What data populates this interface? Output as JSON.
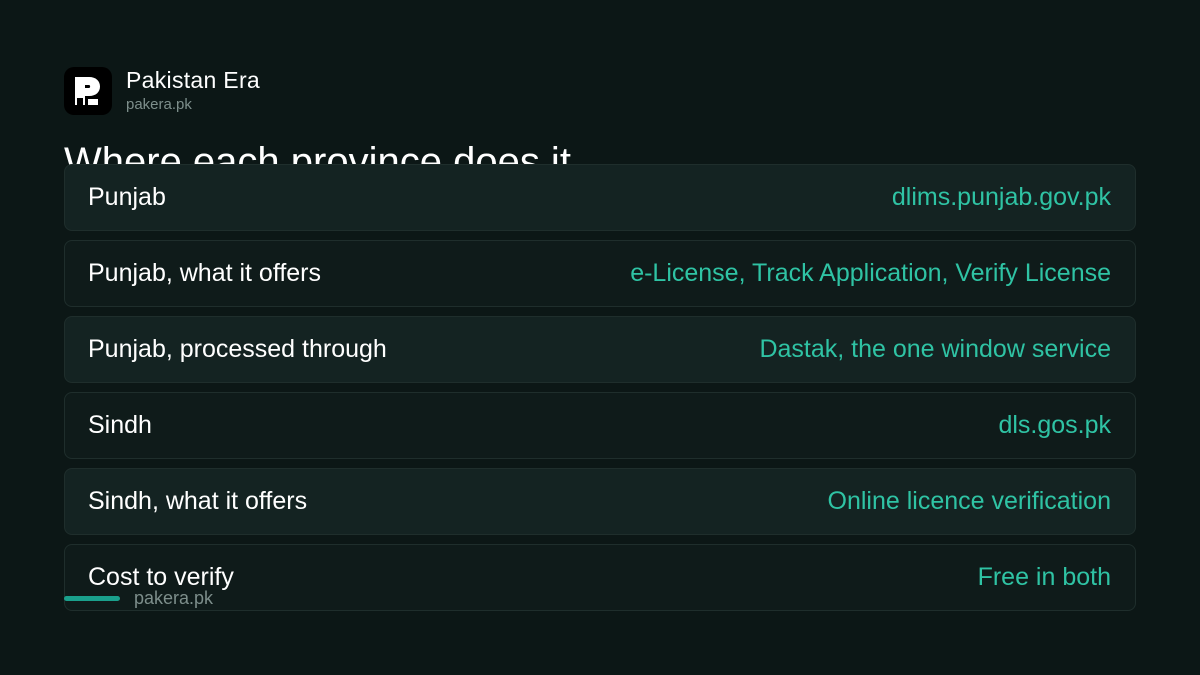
{
  "brand": {
    "name": "Pakistan Era",
    "domain": "pakera.pk"
  },
  "heading": "Where each province does it",
  "rows": [
    {
      "label": "Punjab",
      "value": "dlims.punjab.gov.pk"
    },
    {
      "label": "Punjab, what it offers",
      "value": "e-License, Track Application, Verify License"
    },
    {
      "label": "Punjab, processed through",
      "value": "Dastak, the one window service"
    },
    {
      "label": "Sindh",
      "value": "dls.gos.pk"
    },
    {
      "label": "Sindh, what it offers",
      "value": "Online licence verification"
    },
    {
      "label": "Cost to verify",
      "value": "Free in both"
    }
  ],
  "footer": {
    "domain": "pakera.pk"
  },
  "colors": {
    "background": "#0c1716",
    "accent": "#2fc3a4",
    "muted": "#7d8e8b",
    "footer_bar": "#1aa08c"
  },
  "icons": {
    "logo": "pakera-logo-icon"
  }
}
